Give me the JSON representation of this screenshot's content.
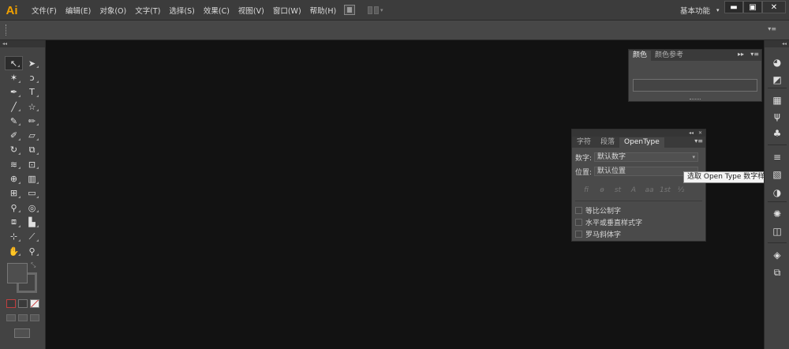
{
  "app": {
    "logo": "Ai",
    "menu": [
      "文件(F)",
      "编辑(E)",
      "对象(O)",
      "文字(T)",
      "选择(S)",
      "效果(C)",
      "视图(V)",
      "窗口(W)",
      "帮助(H)"
    ],
    "workspace": "基本功能",
    "window_controls": {
      "minimize": "▬",
      "maximize": "▣",
      "close": "✕"
    }
  },
  "control_bar": {
    "menu_glyph": "▾≡"
  },
  "toolbar": {
    "collapse_glyph": "◂◂",
    "tools": [
      {
        "name": "selection-tool",
        "glyph": "↖",
        "active": true
      },
      {
        "name": "direct-selection-tool",
        "glyph": "➤"
      },
      {
        "name": "magic-wand-tool",
        "glyph": "✶"
      },
      {
        "name": "lasso-tool",
        "glyph": "ↄ"
      },
      {
        "name": "pen-tool",
        "glyph": "✒"
      },
      {
        "name": "type-tool",
        "glyph": "T"
      },
      {
        "name": "line-segment-tool",
        "glyph": "╱"
      },
      {
        "name": "star-tool",
        "glyph": "☆"
      },
      {
        "name": "paintbrush-tool",
        "glyph": "✎"
      },
      {
        "name": "pencil-tool",
        "glyph": "✏"
      },
      {
        "name": "blob-brush-tool",
        "glyph": "✐"
      },
      {
        "name": "eraser-tool",
        "glyph": "▱"
      },
      {
        "name": "rotate-tool",
        "glyph": "↻"
      },
      {
        "name": "scale-tool",
        "glyph": "⧉"
      },
      {
        "name": "warp-tool",
        "glyph": "≋"
      },
      {
        "name": "free-transform-tool",
        "glyph": "⊡"
      },
      {
        "name": "shape-builder-tool",
        "glyph": "⊕"
      },
      {
        "name": "perspective-grid-tool",
        "glyph": "▥"
      },
      {
        "name": "mesh-tool",
        "glyph": "⊞"
      },
      {
        "name": "gradient-tool",
        "glyph": "▭"
      },
      {
        "name": "eyedropper-tool",
        "glyph": "⚲"
      },
      {
        "name": "blend-tool",
        "glyph": "◎"
      },
      {
        "name": "symbol-sprayer-tool",
        "glyph": "⧈"
      },
      {
        "name": "column-graph-tool",
        "glyph": "▙"
      },
      {
        "name": "artboard-tool",
        "glyph": "⊹"
      },
      {
        "name": "slice-tool",
        "glyph": "⟋"
      },
      {
        "name": "hand-tool",
        "glyph": "✋"
      },
      {
        "name": "zoom-tool",
        "glyph": "⚲"
      }
    ]
  },
  "color_panel": {
    "tabs": [
      "颜色",
      "颜色参考"
    ],
    "expand_glyph": "▸▸",
    "menu_glyph": "▾≡"
  },
  "opentype_panel": {
    "titlebar_collapse": "◂◂",
    "titlebar_close": "✕",
    "tabs": [
      "字符",
      "段落",
      "OpenType"
    ],
    "menu_glyph": "▾≡",
    "figure_label": "数字:",
    "figure_value": "默认数字",
    "position_label": "位置:",
    "position_value": "默认位置",
    "feature_icons": [
      "fi",
      "ɵ",
      "st",
      "A",
      "aa",
      "1st",
      "½"
    ],
    "checkboxes": [
      "等比公制字",
      "水平或垂直样式字",
      "罗马斜体字"
    ]
  },
  "tooltip": {
    "text": "选取 Open Type 数字样式"
  },
  "dock": {
    "collapse_glyph": "◂◂",
    "icons": [
      "color-guide-icon",
      "color-icon",
      "swatches-icon",
      "brushes-icon",
      "symbols-icon",
      "stroke-icon",
      "gradient-icon",
      "transparency-icon",
      "appearance-icon",
      "graphic-styles-icon",
      "layers-icon",
      "artboards-icon"
    ],
    "glyphs": [
      "◕",
      "◩",
      "▦",
      "ψ",
      "♣",
      "≡",
      "▧",
      "◑",
      "✺",
      "◫",
      "◈",
      "⧉"
    ]
  }
}
